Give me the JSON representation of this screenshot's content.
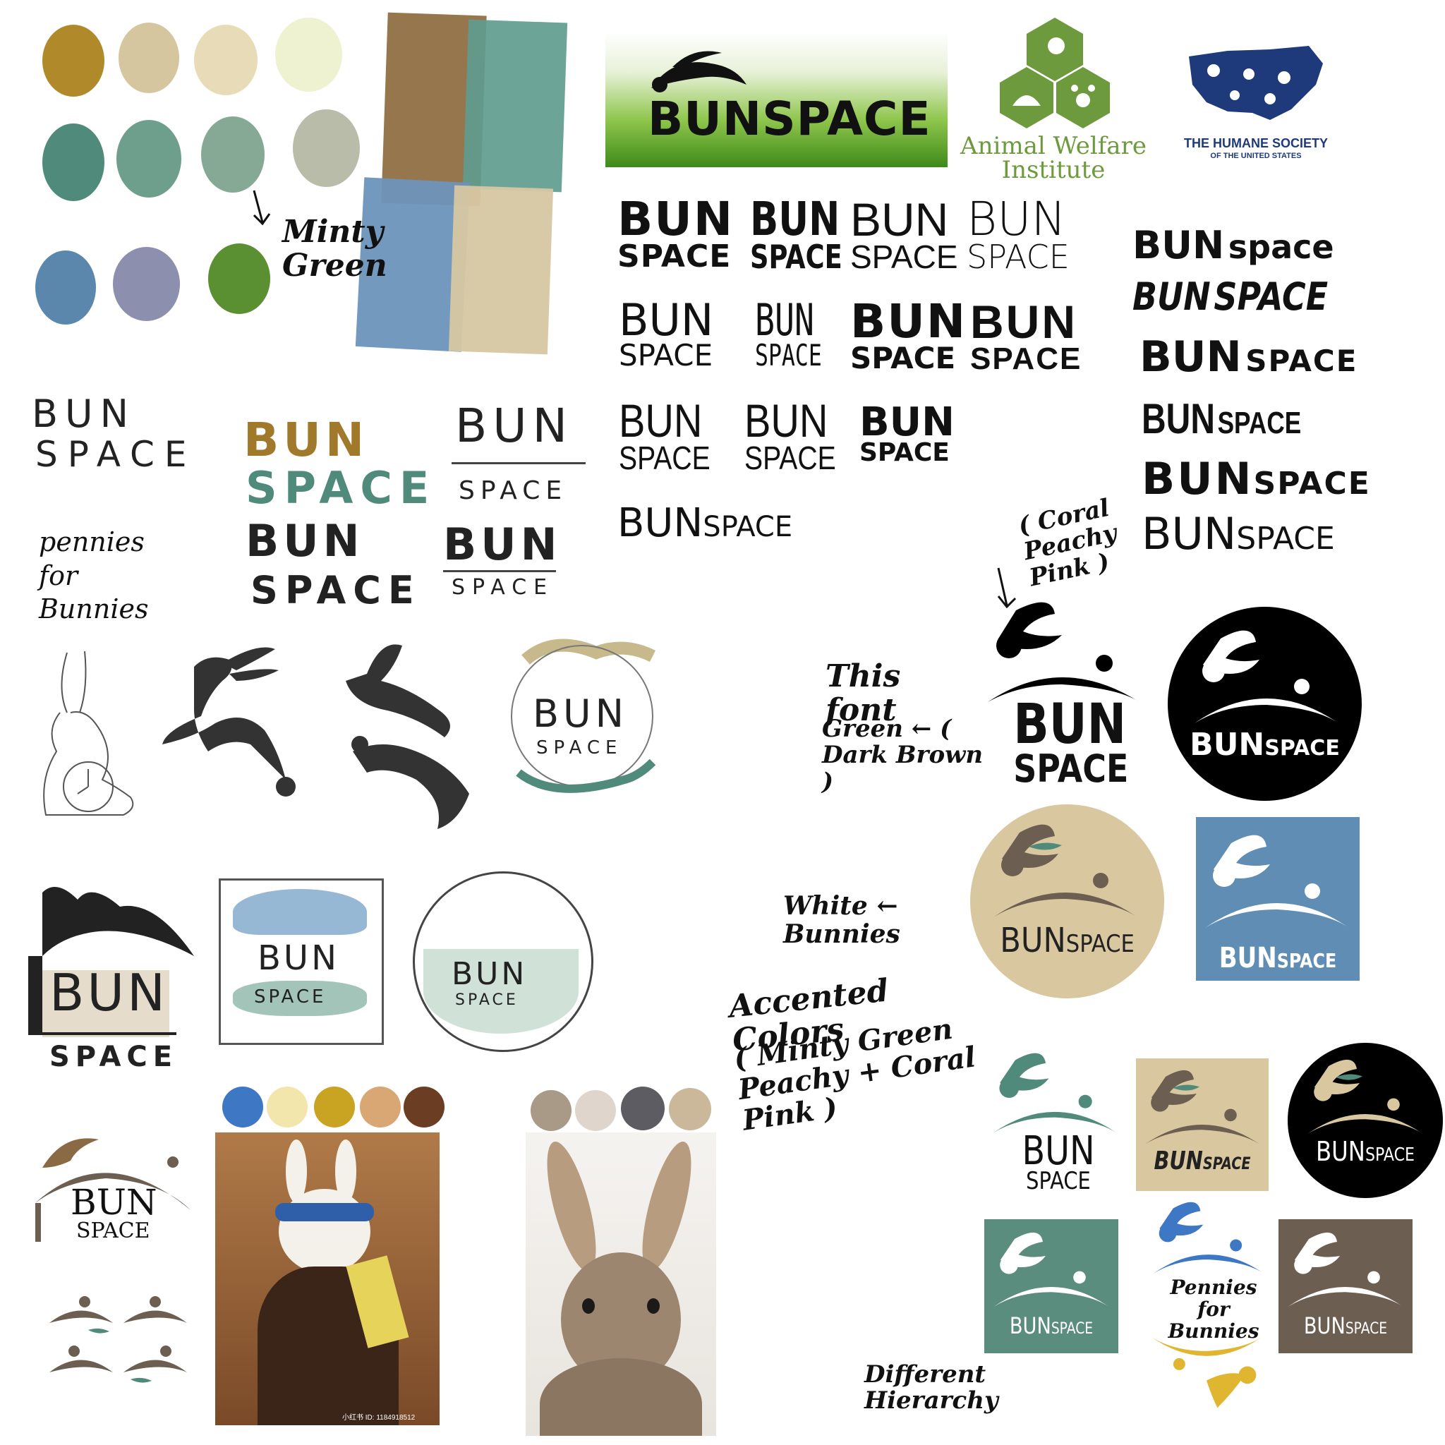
{
  "colors": {
    "gold": "#b08a2a",
    "tan": "#d5c6a0",
    "cream": "#e8dcb8",
    "pale_yellow": "#eef2d0",
    "teal_dark": "#4f8a7a",
    "teal_mid": "#6e9e8c",
    "minty_green": "#86a996",
    "sage": "#b8bca8",
    "blue": "#5b87ad",
    "lavender": "#8c8fad",
    "grass_green": "#5a8f32",
    "dark_brown": "#6d5e52",
    "beige": "#d9c7a0",
    "steel_blue": "#5f8db4",
    "black": "#000000",
    "bright_blue": "#3e78c4",
    "mustard": "#e0b631",
    "awi_green": "#6c9a3d",
    "hs_navy": "#1f3a7a"
  },
  "notes": {
    "minty_green": "Minty Green",
    "coral": "( Coral Peachy Pink )",
    "this_font": "This font",
    "green_dark_brown": "Green ← ( Dark Brown )",
    "white_bunnies": "White ← Bunnies",
    "accented": "Accented Colors",
    "accented_detail": "( Minty Green Peachy + Coral Pink )",
    "hierarchy": "Different Hierarchy"
  },
  "brand_logos": {
    "bunspace_banner": "BUNSPACE",
    "awi": "Animal Welfare Institute",
    "humane_title": "THE HUMANE SOCIETY",
    "humane_sub": "OF THE UNITED STATES"
  },
  "wordmark": {
    "bun": "BUN",
    "space": "SPACE",
    "space_lower": "space",
    "bunspace": "BUNSPACE"
  },
  "sketch": {
    "bun": "BUN",
    "space": "SPACE",
    "pennies": "pennies for Bunnies"
  },
  "logo_texts": {
    "bun": "BUN",
    "space": "SPACE",
    "pennies": "Pennies for Bunnies"
  },
  "photo": {
    "watermark": "小红书 ID: 1184918512"
  }
}
